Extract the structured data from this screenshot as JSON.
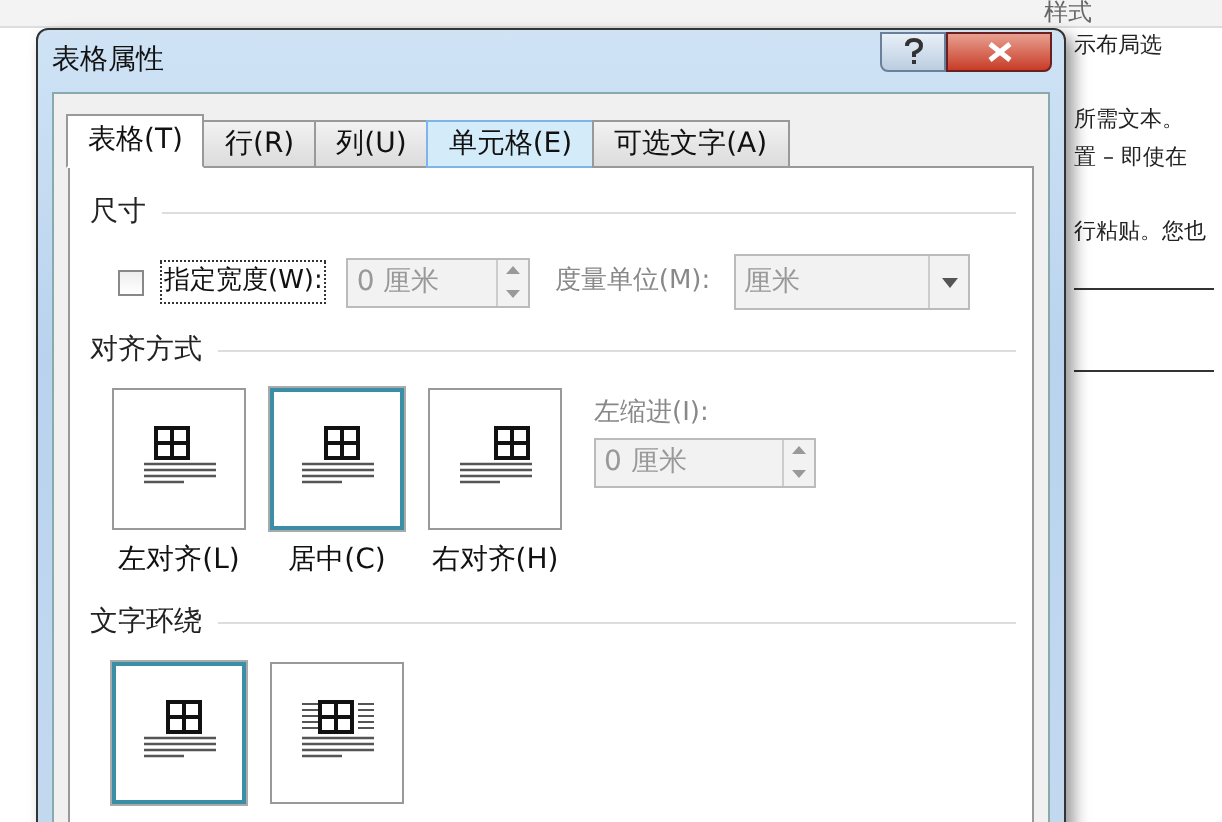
{
  "background": {
    "ribbon_label": "样式",
    "lines": [
      "示布局选",
      "所需文本。",
      "置 – 即使在",
      "行粘贴。您也"
    ]
  },
  "window": {
    "title": "表格属性"
  },
  "tabs": [
    {
      "label": "表格(T)",
      "selected": true,
      "hovered": false
    },
    {
      "label": "行(R)",
      "selected": false,
      "hovered": false
    },
    {
      "label": "列(U)",
      "selected": false,
      "hovered": false
    },
    {
      "label": "单元格(E)",
      "selected": false,
      "hovered": true
    },
    {
      "label": "可选文字(A)",
      "selected": false,
      "hovered": false
    }
  ],
  "size": {
    "heading": "尺寸",
    "width_checkbox": {
      "label": "指定宽度(W):",
      "checked": false
    },
    "width_value": "0 厘米",
    "unit_label": "度量单位(M):",
    "unit_value": "厘米"
  },
  "alignment": {
    "heading": "对齐方式",
    "options": [
      {
        "label": "左对齐(L)",
        "kind": "left",
        "selected": false
      },
      {
        "label": "居中(C)",
        "kind": "center",
        "selected": true
      },
      {
        "label": "右对齐(H)",
        "kind": "right",
        "selected": false
      }
    ],
    "indent_label": "左缩进(I):",
    "indent_value": "0 厘米"
  },
  "wrapping": {
    "heading": "文字环绕",
    "options": [
      {
        "kind": "none",
        "selected": true
      },
      {
        "kind": "around",
        "selected": false
      }
    ]
  }
}
